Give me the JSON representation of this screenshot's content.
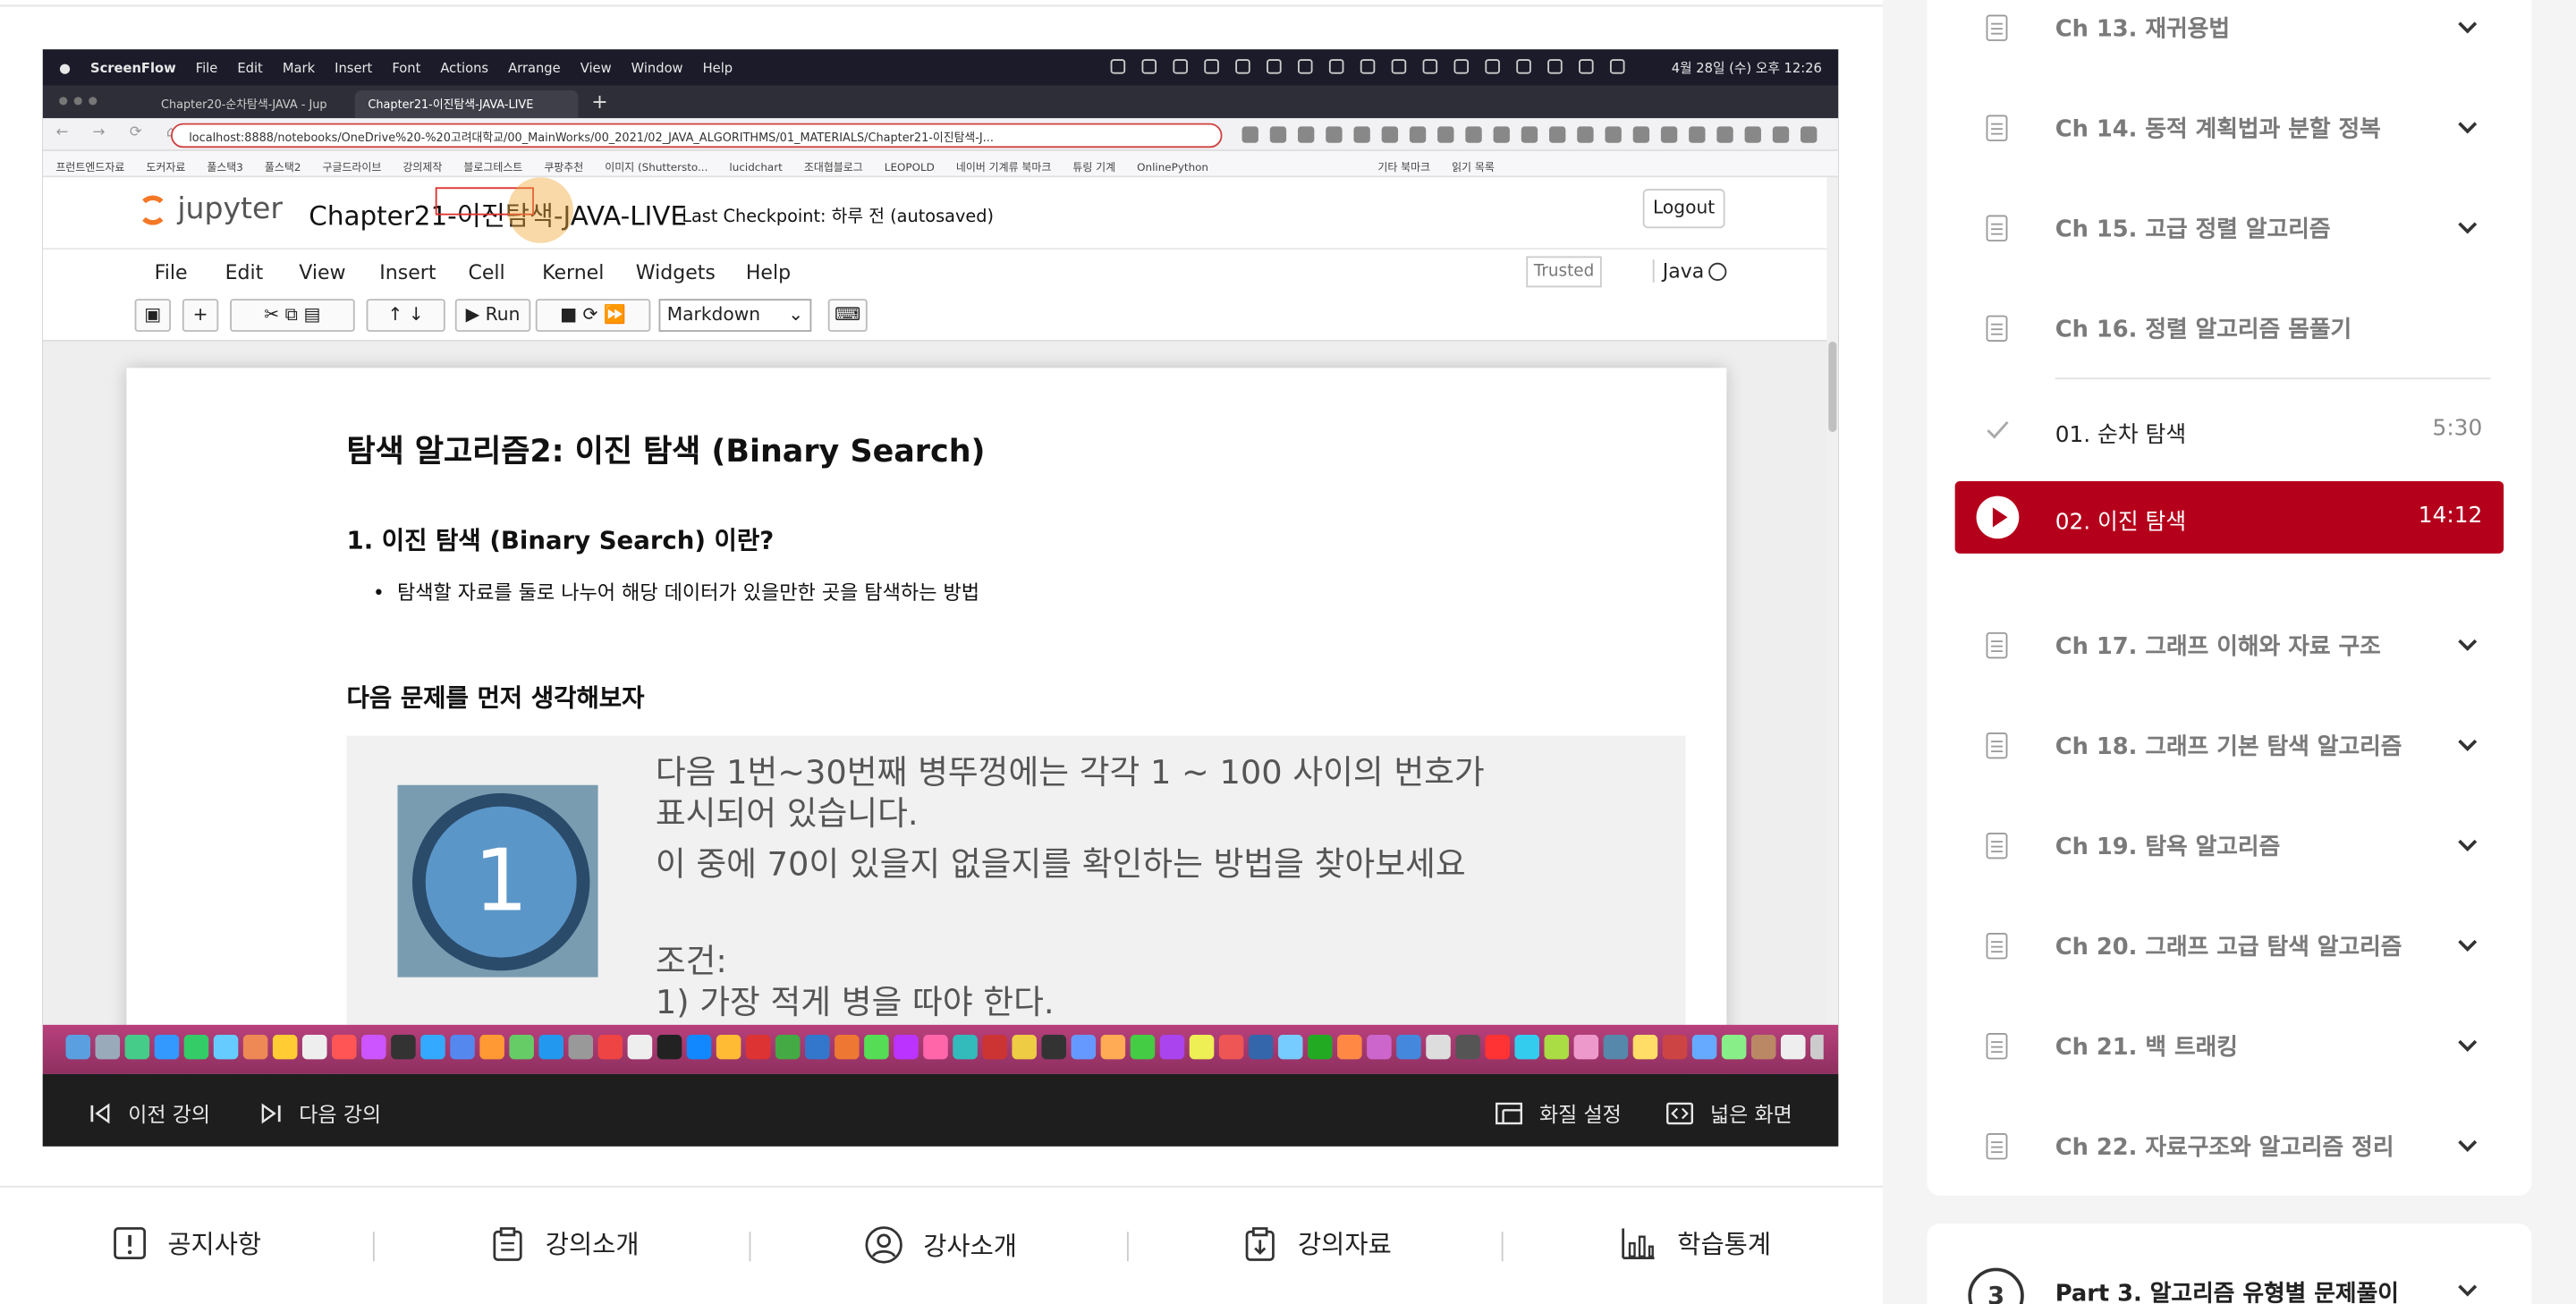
{
  "screen": {
    "menubar": {
      "app": "ScreenFlow",
      "items": [
        "File",
        "Edit",
        "Mark",
        "Insert",
        "Font",
        "Actions",
        "Arrange",
        "View",
        "Window",
        "Help"
      ],
      "clock": "4월 28일 (수) 오후 12:26"
    },
    "tabs": [
      {
        "label": "Chapter20-순차탐색-JAVA - Jup"
      },
      {
        "label": "Chapter21-이진탐색-JAVA-LIVE"
      }
    ],
    "url": "localhost:8888/notebooks/OneDrive%20-%20고려대학교/00_MainWorks/00_2021/02_JAVA_ALGORITHMS/01_MATERIALS/Chapter21-이진탐색-J...",
    "bookmarks": [
      "프런트엔드자료",
      "도커자료",
      "풀스택3",
      "풀스택2",
      "구글드라이브",
      "강의제작",
      "블로그테스트",
      "쿠팡추천",
      "이미지 (Shuttersto...",
      "lucidchart",
      "조대협블로그",
      "LEOPOLD",
      "네이버 기계류 북마크",
      "튜링 기계",
      "OnlinePython",
      "기타 북마크",
      "읽기 목록"
    ],
    "jupyter": {
      "logo": "jupyter",
      "notebook_title": "Chapter21-이진탐색-JAVA-LIVE",
      "checkpoint": "Last Checkpoint: 하루 전  (autosaved)",
      "logout": "Logout",
      "menu": [
        "File",
        "Edit",
        "View",
        "Insert",
        "Cell",
        "Kernel",
        "Widgets",
        "Help"
      ],
      "trusted": "Trusted",
      "kernel": "Java",
      "run_label": "Run",
      "cell_type": "Markdown"
    },
    "notebook": {
      "h2": "탐색 알고리즘2: 이진 탐색 (Binary Search)",
      "h3": "1. 이진 탐색 (Binary Search) 이란?",
      "bullet": "탐색할 자료를 둘로 나누어 해당 데이터가 있을만한 곳을 탐색하는 방법",
      "h3b": "다음 문제를 먼저 생각해보자",
      "cap_number": "1",
      "problem_lines": [
        "다음 1번~30번째 병뚜껑에는 각각 1 ~ 100 사이의 번호가",
        "표시되어 있습니다.",
        "이 중에 70이 있을지 없을지를 확인하는 방법을 찾아보세요",
        "조건:",
        "1)   가장 적게 병을 따야 한다."
      ]
    }
  },
  "player": {
    "prev": "이전 강의",
    "next": "다음 강의",
    "quality": "화질 설정",
    "wide": "넓은 화면"
  },
  "bottom_nav": [
    "공지사항",
    "강의소개",
    "강사소개",
    "강의자료",
    "학습통계"
  ],
  "sidebar": {
    "chapters_top": [
      "Ch 13. 재귀용법",
      "Ch 14. 동적 계획법과 분할 정복",
      "Ch 15. 고급 정렬 알고리즘",
      "Ch 16. 정렬 알고리즘 몸풀기"
    ],
    "lessons": [
      {
        "title": "01. 순차 탐색",
        "duration": "5:30"
      },
      {
        "title": "02. 이진 탐색",
        "duration": "14:12"
      }
    ],
    "chapters_bottom": [
      "Ch 17. 그래프 이해와 자료 구조",
      "Ch 18. 그래프 기본 탐색 알고리즘",
      "Ch 19. 탐욕 알고리즘",
      "Ch 20. 그래프 고급 탐색 알고리즘",
      "Ch 21. 백 트래킹",
      "Ch 22. 자료구조와 알고리즘 정리"
    ],
    "part": {
      "number": "3",
      "label": "Part 3. 알고리즘 유형별 문제풀이"
    }
  },
  "colors": {
    "accent": "#b5001b",
    "jupyter_orange": "#f37726"
  }
}
